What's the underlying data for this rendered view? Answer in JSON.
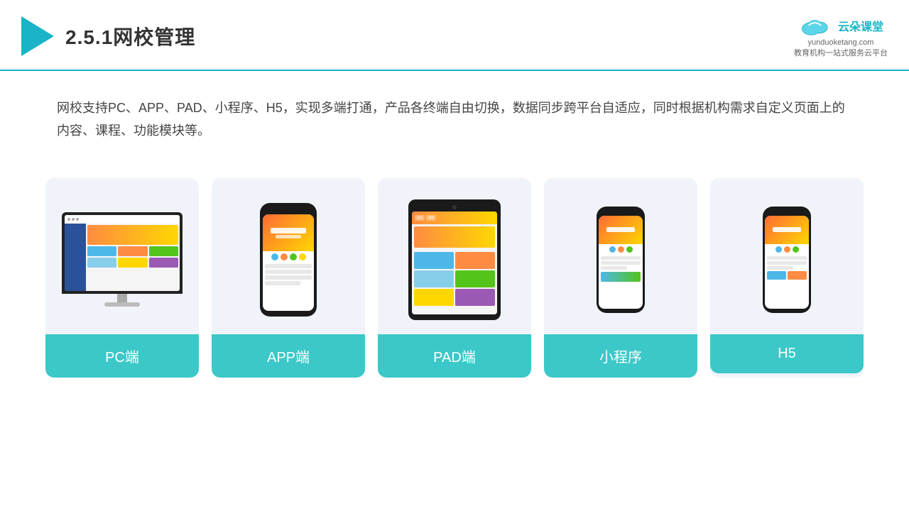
{
  "header": {
    "title": "2.5.1网校管理",
    "brand": {
      "name": "云朵课堂",
      "url": "yunduoketang.com",
      "tagline": "教育机构一站\n式服务云平台"
    }
  },
  "description": "网校支持PC、APP、PAD、小程序、H5，实现多端打通，产品各终端自由切换，数据同步跨平台自适应，同时根据机构需求自定义页面上的内容、课程、功能模块等。",
  "cards": [
    {
      "id": "pc",
      "label": "PC端"
    },
    {
      "id": "app",
      "label": "APP端"
    },
    {
      "id": "pad",
      "label": "PAD端"
    },
    {
      "id": "miniprogram",
      "label": "小程序"
    },
    {
      "id": "h5",
      "label": "H5"
    }
  ],
  "colors": {
    "primary": "#1ab3c8",
    "card_bg": "#f0f4fa",
    "card_label": "#3cc8c8",
    "text_dark": "#333333",
    "text_body": "#444444"
  }
}
